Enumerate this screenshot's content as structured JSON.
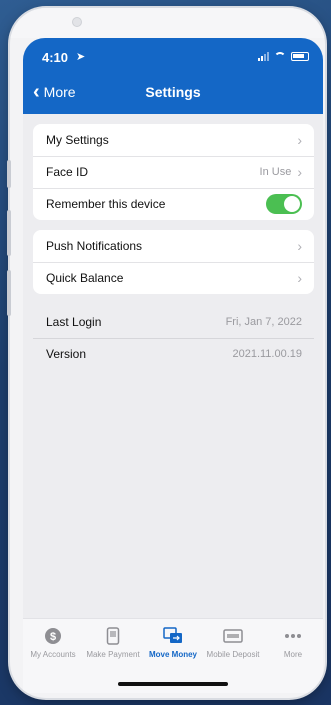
{
  "status_bar": {
    "time": "4:10"
  },
  "header": {
    "back_label": "More",
    "title": "Settings"
  },
  "group1": [
    {
      "label": "My Settings",
      "value": ""
    },
    {
      "label": "Face ID",
      "value": "In Use"
    },
    {
      "label": "Remember this device",
      "toggle": true
    }
  ],
  "group2": [
    {
      "label": "Push Notifications"
    },
    {
      "label": "Quick Balance"
    }
  ],
  "info": [
    {
      "label": "Last Login",
      "value": "Fri, Jan 7, 2022"
    },
    {
      "label": "Version",
      "value": "2021.11.00.19"
    }
  ],
  "tabbar": {
    "tabs": [
      {
        "label": "My Accounts",
        "icon": "dollar-icon"
      },
      {
        "label": "Make Payment",
        "icon": "phone-payment-icon"
      },
      {
        "label": "Move Money",
        "icon": "transfer-icon",
        "active": true
      },
      {
        "label": "Mobile Deposit",
        "icon": "check-deposit-icon"
      },
      {
        "label": "More",
        "icon": "more-dots-icon"
      }
    ]
  },
  "colors": {
    "accent": "#1467c6",
    "toggle_on": "#4bbf52"
  }
}
